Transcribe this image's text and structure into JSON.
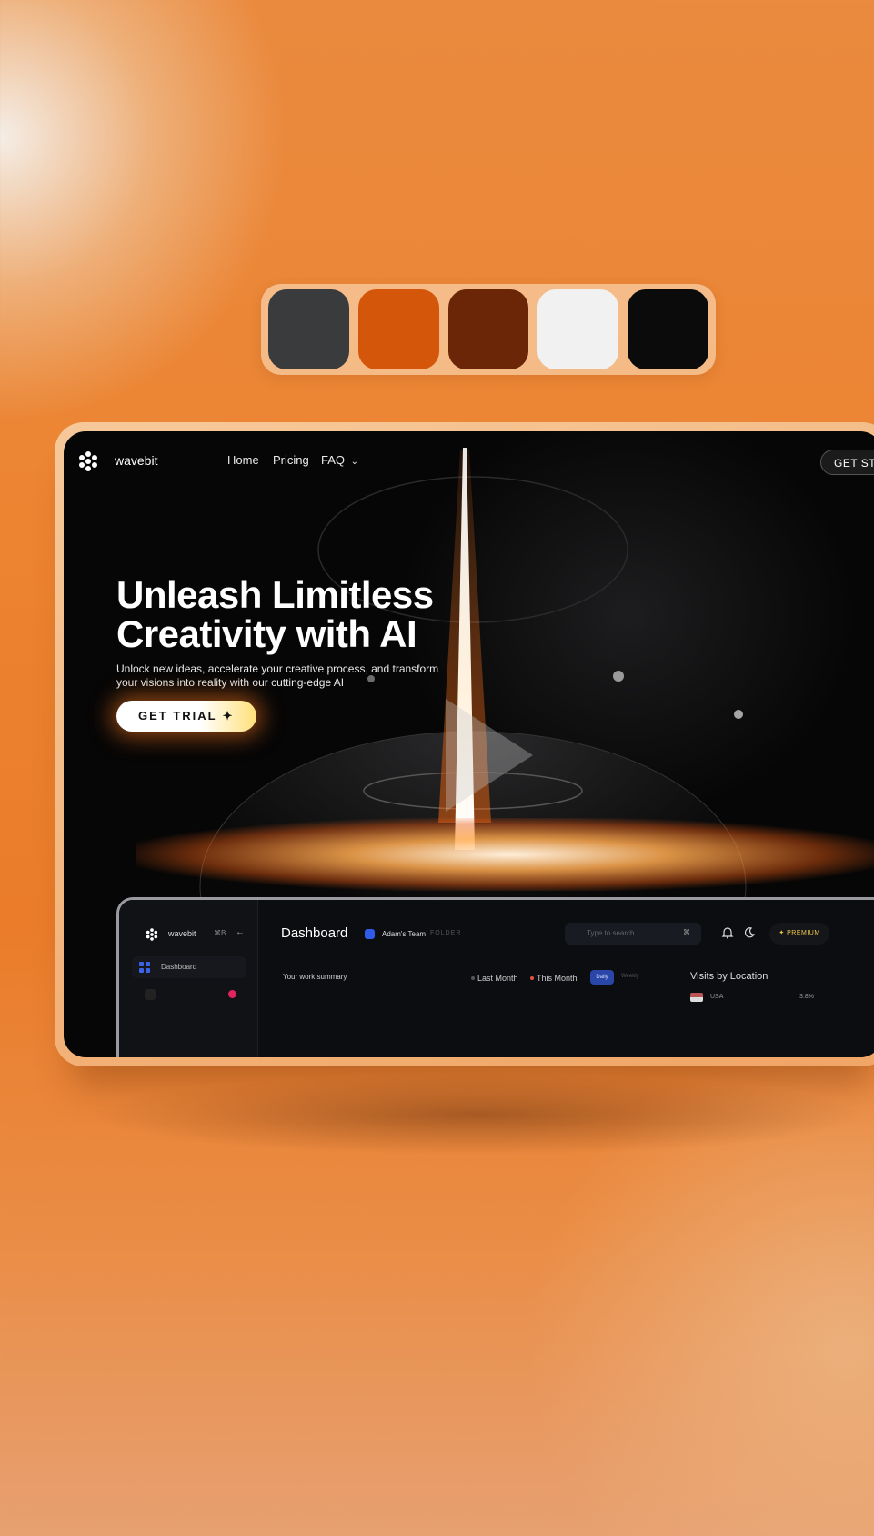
{
  "palette": {
    "colors": [
      "#3a3b3d",
      "#d4560b",
      "#6b2608",
      "#f1f1f1",
      "#0b0b0b"
    ]
  },
  "nav": {
    "brand": "wavebit",
    "links": [
      "Home",
      "Pricing",
      "FAQ"
    ],
    "cta": "GET STAR"
  },
  "hero": {
    "title_line1": "Unleash Limitless",
    "title_line2": "Creativity with AI",
    "subtitle_line1": "Unlock new ideas, accelerate your creative process, and transform",
    "subtitle_line2": "your visions into reality with our cutting-edge AI",
    "button": "GET TRIAL"
  },
  "dashboard": {
    "brand": "wavebit",
    "shortcut": "⌘B",
    "sidebar_active": "Dashboard",
    "title": "Dashboard",
    "team": "Adam's Team",
    "team_folder": "FOLDER",
    "search_placeholder": "Type to search",
    "search_key": "⌘",
    "premium": "PREMIUM",
    "summary_title": "Your work summary",
    "last_month": "Last Month",
    "this_month": "This Month",
    "daily": "Daily",
    "weekly": "Weekly",
    "visits_title": "Visits by Location",
    "visits_row_country": "USA",
    "visits_row_value": "3.8%"
  },
  "colors": {
    "accent": "#f08a2e",
    "frame": "#f3b77c",
    "background": "#ea8538"
  }
}
